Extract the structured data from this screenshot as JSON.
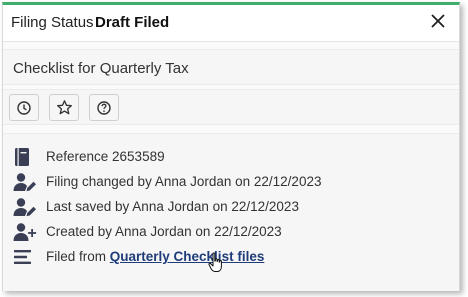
{
  "header": {
    "label": "Filing Status",
    "status": "Draft Filed"
  },
  "document": {
    "title": "Checklist for Quarterly Tax"
  },
  "toolbar": {
    "buttons": [
      {
        "icon": "clock-icon"
      },
      {
        "icon": "star-icon"
      },
      {
        "icon": "help-icon"
      }
    ]
  },
  "details": {
    "reference": "Reference 2653589",
    "filing_changed": "Filing changed by Anna Jordan on 22/12/2023",
    "last_saved": "Last saved by Anna Jordan on 22/12/2023",
    "created": "Created by Anna Jordan on 22/12/2023",
    "filed_from_prefix": "Filed from ",
    "filed_from_link": "Quarterly Checklist files"
  },
  "colors": {
    "accent": "#3fae6c",
    "link": "#1f3c7a",
    "icon": "#3a3f55"
  }
}
